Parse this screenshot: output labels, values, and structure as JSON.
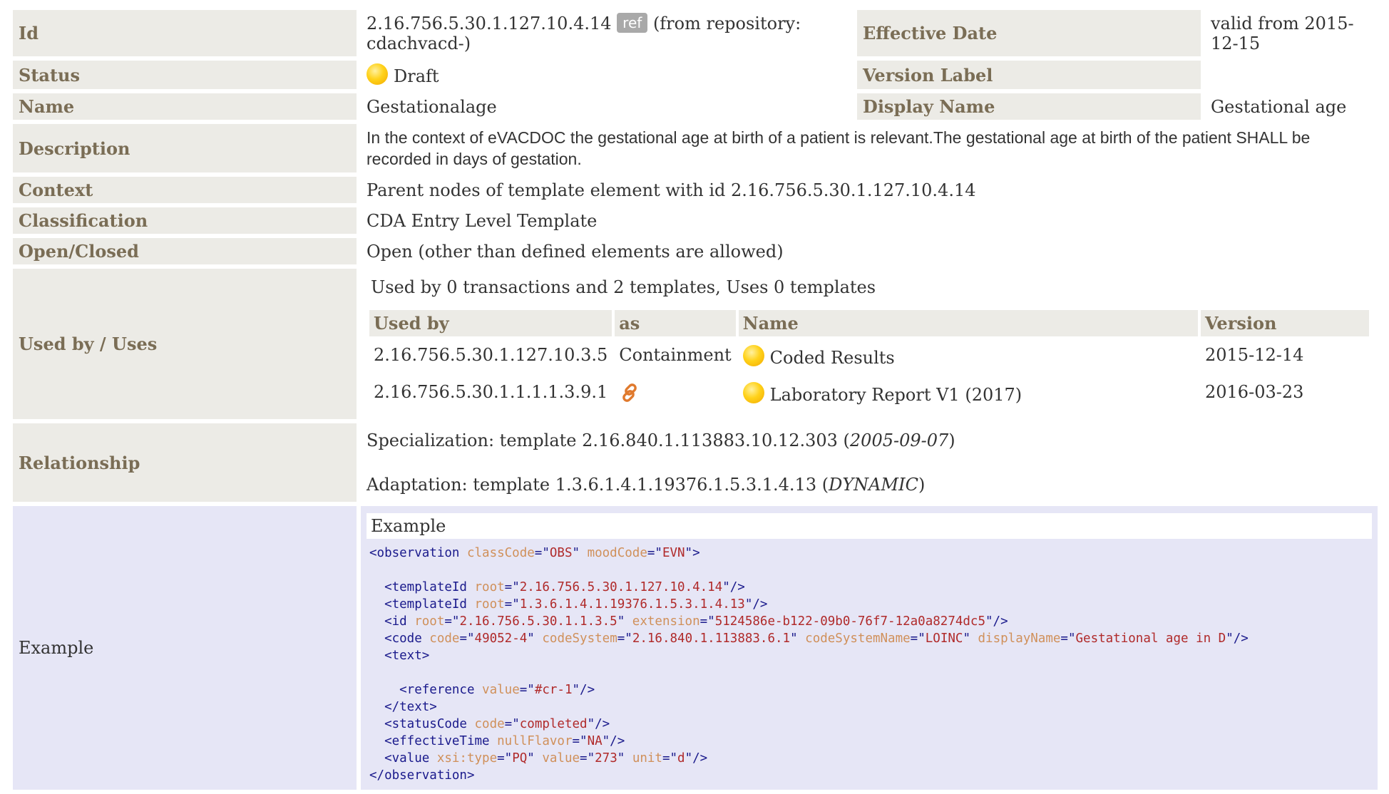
{
  "id": {
    "label": "Id",
    "value": "2.16.756.5.30.1.127.10.4.14",
    "badge": "ref",
    "repository": "(from repository: cdachvacd-)"
  },
  "effective_date": {
    "label": "Effective Date",
    "value": "valid from 2015-12-15"
  },
  "status": {
    "label": "Status",
    "value": "Draft",
    "icon": "status-draft-icon",
    "color": "#ffd21a"
  },
  "version_label": {
    "label": "Version Label",
    "value": ""
  },
  "name": {
    "label": "Name",
    "value": "Gestationalage"
  },
  "display_name": {
    "label": "Display Name",
    "value": "Gestational age"
  },
  "description": {
    "label": "Description",
    "value": "In the context of eVACDOC the gestational age at birth of a patient is relevant.The gestational age at birth of the patient SHALL be recorded in days of gestation."
  },
  "context": {
    "label": "Context",
    "value": "Parent nodes of template element with id 2.16.756.5.30.1.127.10.4.14"
  },
  "classification": {
    "label": "Classification",
    "value": "CDA Entry Level Template"
  },
  "open_closed": {
    "label": "Open/Closed",
    "value": "Open (other than defined elements are allowed)"
  },
  "usage": {
    "label": "Used by / Uses",
    "summary": "Used by 0 transactions and 2 templates, Uses 0 templates",
    "headers": [
      "Used by",
      "as",
      "Name",
      "Version"
    ],
    "rows": [
      {
        "used_by": "2.16.756.5.30.1.127.10.3.5",
        "as": "Containment",
        "name": "Coded Results",
        "version": "2015-12-14"
      },
      {
        "used_by": "2.16.756.5.30.1.1.1.1.3.9.1",
        "as": "",
        "as_icon": "link-icon",
        "name": "Laboratory Report V1 (2017)",
        "version": "2016-03-23"
      }
    ]
  },
  "relationship": {
    "label": "Relationship",
    "specialization_prefix": "Specialization: template 2.16.840.1.113883.10.12.303 (",
    "specialization_date": "2005-09-07",
    "adaptation_prefix": "Adaptation: template 1.3.6.1.4.1.19376.1.5.3.1.4.13 (",
    "adaptation_date": "DYNAMIC",
    "close_paren": ")"
  },
  "example": {
    "label": "Example",
    "title": "Example",
    "code": [
      [
        [
          "t",
          "<observation "
        ],
        [
          "a",
          "classCode"
        ],
        [
          "t",
          "=\""
        ],
        [
          "v",
          "OBS"
        ],
        [
          "t",
          "\" "
        ],
        [
          "a",
          "moodCode"
        ],
        [
          "t",
          "=\""
        ],
        [
          "v",
          "EVN"
        ],
        [
          "t",
          "\">"
        ]
      ],
      [],
      [
        [
          "t",
          "  <templateId "
        ],
        [
          "a",
          "root"
        ],
        [
          "t",
          "=\""
        ],
        [
          "v",
          "2.16.756.5.30.1.127.10.4.14"
        ],
        [
          "t",
          "\"/>"
        ]
      ],
      [
        [
          "t",
          "  <templateId "
        ],
        [
          "a",
          "root"
        ],
        [
          "t",
          "=\""
        ],
        [
          "v",
          "1.3.6.1.4.1.19376.1.5.3.1.4.13"
        ],
        [
          "t",
          "\"/>"
        ]
      ],
      [
        [
          "t",
          "  <id "
        ],
        [
          "a",
          "root"
        ],
        [
          "t",
          "=\""
        ],
        [
          "v",
          "2.16.756.5.30.1.1.3.5"
        ],
        [
          "t",
          "\" "
        ],
        [
          "a",
          "extension"
        ],
        [
          "t",
          "=\""
        ],
        [
          "v",
          "5124586e-b122-09b0-76f7-12a0a8274dc5"
        ],
        [
          "t",
          "\"/>"
        ]
      ],
      [
        [
          "t",
          "  <code "
        ],
        [
          "a",
          "code"
        ],
        [
          "t",
          "=\""
        ],
        [
          "v",
          "49052-4"
        ],
        [
          "t",
          "\" "
        ],
        [
          "a",
          "codeSystem"
        ],
        [
          "t",
          "=\""
        ],
        [
          "v",
          "2.16.840.1.113883.6.1"
        ],
        [
          "t",
          "\" "
        ],
        [
          "a",
          "codeSystemName"
        ],
        [
          "t",
          "=\""
        ],
        [
          "v",
          "LOINC"
        ],
        [
          "t",
          "\" "
        ],
        [
          "a",
          "displayName"
        ],
        [
          "t",
          "=\""
        ],
        [
          "v",
          "Gestational age in D"
        ],
        [
          "t",
          "\"/>"
        ]
      ],
      [
        [
          "t",
          "  <text>"
        ]
      ],
      [],
      [
        [
          "t",
          "    <reference "
        ],
        [
          "a",
          "value"
        ],
        [
          "t",
          "=\""
        ],
        [
          "v",
          "#cr-1"
        ],
        [
          "t",
          "\"/>"
        ]
      ],
      [
        [
          "t",
          "  </text>"
        ]
      ],
      [
        [
          "t",
          "  <statusCode "
        ],
        [
          "a",
          "code"
        ],
        [
          "t",
          "=\""
        ],
        [
          "v",
          "completed"
        ],
        [
          "t",
          "\"/>"
        ]
      ],
      [
        [
          "t",
          "  <effectiveTime "
        ],
        [
          "a",
          "nullFlavor"
        ],
        [
          "t",
          "=\""
        ],
        [
          "v",
          "NA"
        ],
        [
          "t",
          "\"/>"
        ]
      ],
      [
        [
          "t",
          "  <value "
        ],
        [
          "a",
          "xsi:type"
        ],
        [
          "t",
          "=\""
        ],
        [
          "v",
          "PQ"
        ],
        [
          "t",
          "\" "
        ],
        [
          "a",
          "value"
        ],
        [
          "t",
          "=\""
        ],
        [
          "v",
          "273"
        ],
        [
          "t",
          "\" "
        ],
        [
          "a",
          "unit"
        ],
        [
          "t",
          "=\""
        ],
        [
          "v",
          "d"
        ],
        [
          "t",
          "\"/>"
        ]
      ],
      [
        [
          "t",
          "</observation>"
        ]
      ]
    ]
  }
}
